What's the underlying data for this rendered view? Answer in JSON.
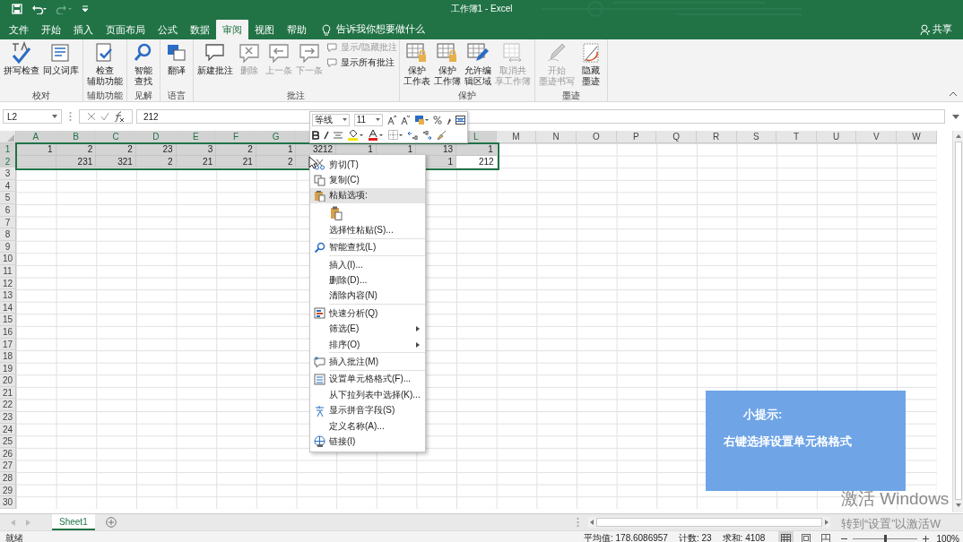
{
  "title_bar": {
    "title": "工作簿1  -  Excel"
  },
  "ribbon_tabs": [
    {
      "label": "文件",
      "selected": false
    },
    {
      "label": "开始",
      "selected": false
    },
    {
      "label": "插入",
      "selected": false
    },
    {
      "label": "页面布局",
      "selected": false
    },
    {
      "label": "公式",
      "selected": false
    },
    {
      "label": "数据",
      "selected": false
    },
    {
      "label": "审阅",
      "selected": true
    },
    {
      "label": "视图",
      "selected": false
    },
    {
      "label": "帮助",
      "selected": false
    }
  ],
  "tell_me": "告诉我你想要做什么",
  "share": "共享",
  "ribbon_groups": [
    {
      "label": "校对",
      "commands": [
        {
          "kind": "large",
          "label_lines": [
            "拼写检查"
          ],
          "disabled": false
        },
        {
          "kind": "large",
          "label_lines": [
            "同义词库"
          ],
          "disabled": false
        }
      ]
    },
    {
      "label": "辅助功能",
      "commands": [
        {
          "kind": "large",
          "label_lines": [
            "检查",
            "辅助功能"
          ],
          "disabled": false
        }
      ]
    },
    {
      "label": "见解",
      "commands": [
        {
          "kind": "large",
          "label_lines": [
            "智能",
            "查找"
          ],
          "disabled": false
        }
      ]
    },
    {
      "label": "语言",
      "commands": [
        {
          "kind": "large",
          "label_lines": [
            "翻译"
          ],
          "disabled": false
        }
      ]
    },
    {
      "label": "批注",
      "commands": [
        {
          "kind": "large",
          "label_lines": [
            "新建批注"
          ],
          "disabled": false
        },
        {
          "kind": "large",
          "label_lines": [
            "删除"
          ],
          "disabled": true
        },
        {
          "kind": "large",
          "label_lines": [
            "上一条"
          ],
          "disabled": true
        },
        {
          "kind": "large",
          "label_lines": [
            "下一条"
          ],
          "disabled": true
        },
        {
          "kind": "small",
          "label_lines": [
            "显示/隐藏批注"
          ],
          "disabled": true
        },
        {
          "kind": "small",
          "label_lines": [
            "显示所有批注"
          ],
          "disabled": false
        }
      ]
    },
    {
      "label": "保护",
      "commands": [
        {
          "kind": "large",
          "label_lines": [
            "保护",
            "工作表"
          ],
          "disabled": false
        },
        {
          "kind": "large",
          "label_lines": [
            "保护",
            "工作簿"
          ],
          "disabled": false
        },
        {
          "kind": "large",
          "label_lines": [
            "允许编",
            "辑区域"
          ],
          "disabled": false
        },
        {
          "kind": "large",
          "label_lines": [
            "取消共",
            "享工作簿"
          ],
          "disabled": true
        }
      ]
    },
    {
      "label": "墨迹",
      "commands": [
        {
          "kind": "large",
          "label_lines": [
            "开始",
            "墨迹书写"
          ],
          "disabled": true
        },
        {
          "kind": "large",
          "label_lines": [
            "隐藏",
            "墨迹"
          ],
          "disabled": false
        }
      ]
    }
  ],
  "formula_bar": {
    "name_box": "L2",
    "formula": "212"
  },
  "columns": [
    "A",
    "B",
    "C",
    "D",
    "E",
    "F",
    "G",
    null,
    null,
    null,
    null,
    "L",
    "M",
    "N",
    "O",
    "P",
    "Q",
    "R",
    "S",
    "T",
    "U",
    "V",
    "W"
  ],
  "rows": [
    {
      "number": "1",
      "selected": true,
      "cells": [
        {
          "value": "1"
        },
        {
          "value": "2"
        },
        {
          "value": "2"
        },
        {
          "value": "23"
        },
        {
          "value": "3"
        },
        {
          "value": "2"
        },
        {
          "value": "1"
        },
        {
          "value": "3212"
        },
        {
          "value": "1"
        },
        {
          "value": "1"
        },
        {
          "value": "13"
        },
        {
          "value": "1"
        }
      ]
    },
    {
      "number": "2",
      "selected": true,
      "cells": [
        null,
        {
          "value": "231"
        },
        {
          "value": "321"
        },
        {
          "value": "2"
        },
        {
          "value": "21"
        },
        {
          "value": "21"
        },
        {
          "value": "2"
        },
        null,
        null,
        null,
        {
          "value": "1"
        },
        {
          "value": "212",
          "active": true
        }
      ]
    },
    {
      "number": "3",
      "selected": false
    },
    {
      "number": "4",
      "selected": false
    },
    {
      "number": "5",
      "selected": false
    },
    {
      "number": "6",
      "selected": false
    },
    {
      "number": "7",
      "selected": false
    },
    {
      "number": "8",
      "selected": false
    },
    {
      "number": "9",
      "selected": false
    },
    {
      "number": "10",
      "selected": false
    },
    {
      "number": "11",
      "selected": false
    },
    {
      "number": "12",
      "selected": false
    },
    {
      "number": "13",
      "selected": false
    },
    {
      "number": "14",
      "selected": false
    },
    {
      "number": "15",
      "selected": false
    },
    {
      "number": "16",
      "selected": false
    },
    {
      "number": "17",
      "selected": false
    },
    {
      "number": "18",
      "selected": false
    },
    {
      "number": "19",
      "selected": false
    },
    {
      "number": "20",
      "selected": false
    },
    {
      "number": "21",
      "selected": false
    },
    {
      "number": "22",
      "selected": false
    },
    {
      "number": "23",
      "selected": false
    },
    {
      "number": "24",
      "selected": false
    },
    {
      "number": "25",
      "selected": false
    },
    {
      "number": "26",
      "selected": false
    },
    {
      "number": "27",
      "selected": false
    },
    {
      "number": "28",
      "selected": false
    },
    {
      "number": "29",
      "selected": false
    },
    {
      "number": "30",
      "selected": false
    }
  ],
  "mini_toolbar": {
    "font": "等线",
    "size": "11"
  },
  "context_menu": [
    {
      "kind": "item",
      "label": "剪切(T)",
      "highlighted": false
    },
    {
      "kind": "item",
      "label": "复制(C)",
      "highlighted": false
    },
    {
      "kind": "item",
      "label": "粘贴选项:",
      "highlighted": true
    },
    {
      "kind": "paste_options"
    },
    {
      "kind": "item",
      "label": "选择性粘贴(S)...",
      "highlighted": false
    },
    {
      "kind": "separator"
    },
    {
      "kind": "item",
      "label": "智能查找(L)",
      "highlighted": false
    },
    {
      "kind": "separator"
    },
    {
      "kind": "item",
      "label": "插入(I)...",
      "highlighted": false
    },
    {
      "kind": "item",
      "label": "删除(D)...",
      "highlighted": false
    },
    {
      "kind": "item",
      "label": "清除内容(N)",
      "highlighted": false
    },
    {
      "kind": "separator"
    },
    {
      "kind": "item",
      "label": "快速分析(Q)",
      "highlighted": false
    },
    {
      "kind": "item",
      "label": "筛选(E)",
      "submenu": true,
      "highlighted": false
    },
    {
      "kind": "item",
      "label": "排序(O)",
      "submenu": true,
      "highlighted": false
    },
    {
      "kind": "separator"
    },
    {
      "kind": "item",
      "label": "插入批注(M)",
      "highlighted": false
    },
    {
      "kind": "separator"
    },
    {
      "kind": "item",
      "label": "设置单元格格式(F)...",
      "highlighted": false
    },
    {
      "kind": "item",
      "label": "从下拉列表中选择(K)...",
      "highlighted": false
    },
    {
      "kind": "item",
      "label": "显示拼音字段(S)",
      "highlighted": false
    },
    {
      "kind": "item",
      "label": "定义名称(A)...",
      "highlighted": false
    },
    {
      "kind": "item",
      "label": "链接(I)",
      "highlighted": false
    }
  ],
  "sheet_tabs": [
    {
      "label": "Sheet1",
      "selected": true
    }
  ],
  "status_bar": {
    "mode": "就绪",
    "average": "平均值: 178.6086957",
    "count": "计数: 23",
    "sum": "求和: 4108",
    "zoom": "100%",
    "zoom_slider": {
      "level": 0.5
    }
  },
  "tip": {
    "title": "小提示:",
    "text": "右键选择设置单元格格式"
  },
  "activation": {
    "title": "激活 Windows",
    "text": "转到“设置”以激活W"
  }
}
